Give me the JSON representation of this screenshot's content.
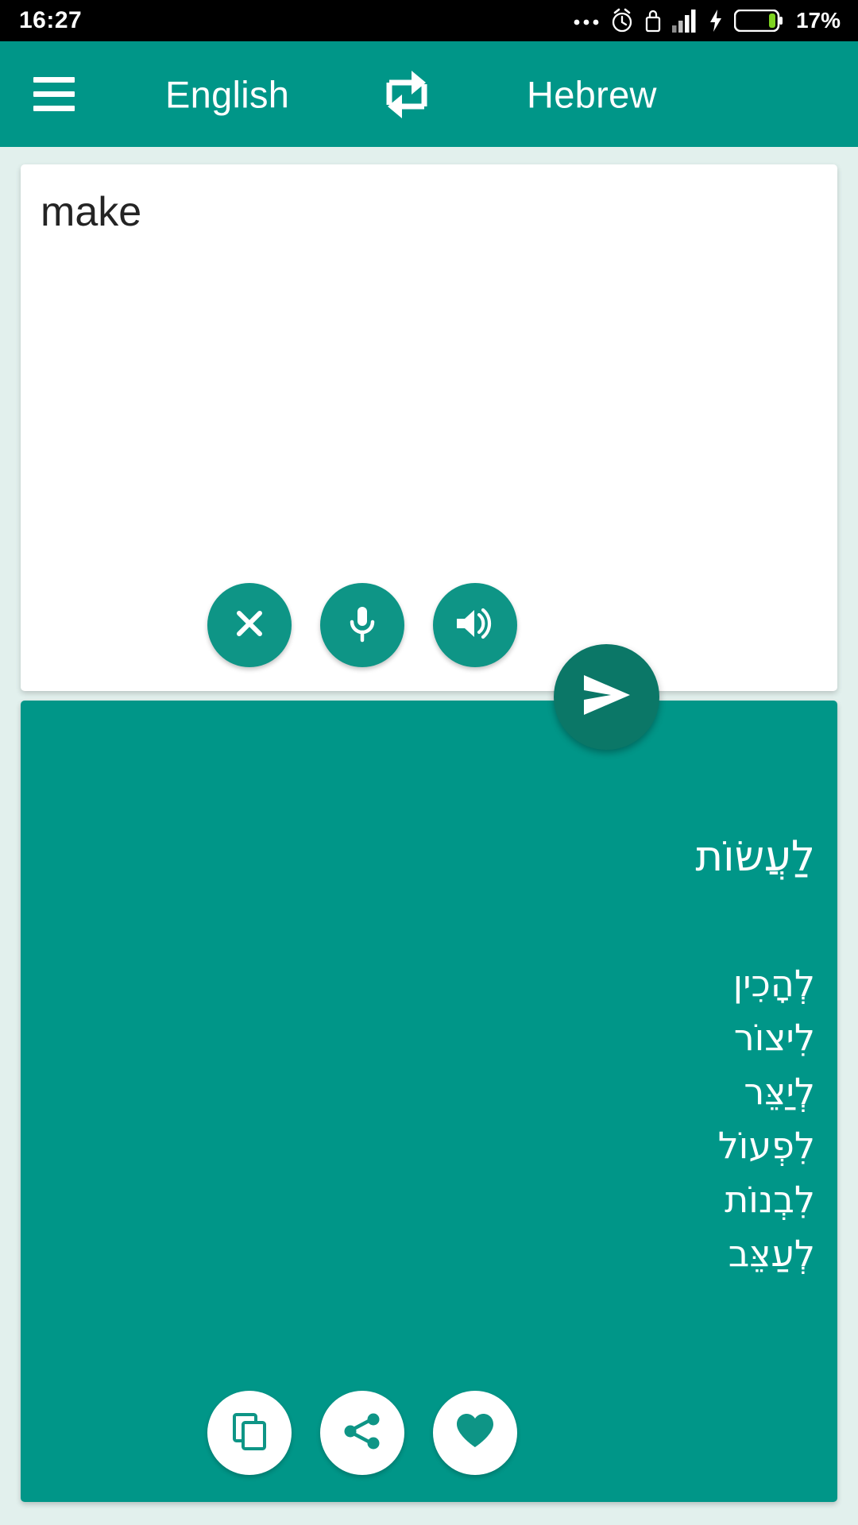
{
  "status_bar": {
    "time": "16:27",
    "battery_percent": "17%",
    "icons": [
      "more-dots-icon",
      "alarm-clock-icon",
      "lock-icon",
      "signal-bars-icon",
      "charging-bolt-icon",
      "battery-icon"
    ]
  },
  "toolbar": {
    "menu_icon": "hamburger-menu-icon",
    "source_language": "English",
    "swap_icon": "swap-languages-icon",
    "target_language": "Hebrew"
  },
  "input": {
    "text": "make",
    "placeholder": "",
    "actions": [
      {
        "name": "clear-button",
        "icon": "close-icon"
      },
      {
        "name": "voice-input-button",
        "icon": "microphone-icon"
      },
      {
        "name": "speak-source-button",
        "icon": "speaker-icon"
      }
    ]
  },
  "send": {
    "icon": "send-icon",
    "label": "Translate"
  },
  "result": {
    "main_translation": "לַעֲשׂוֹת",
    "alternatives": [
      "לְהָכִין",
      "לִיצוֹר",
      "לְיַצֵּר",
      "לִפְעוֹל",
      "לִבְנוֹת",
      "לְעַצֵּב"
    ],
    "actions": [
      {
        "name": "copy-button",
        "icon": "copy-icon"
      },
      {
        "name": "share-button",
        "icon": "share-icon"
      },
      {
        "name": "favorite-button",
        "icon": "heart-icon"
      }
    ]
  },
  "colors": {
    "primary_teal": "#009688",
    "fab_teal": "#0e9586",
    "send_fab_teal": "#0b7767",
    "page_background": "#e2f0ed",
    "card_white": "#ffffff",
    "status_bar_black": "#000000",
    "battery_green": "#7ed321"
  }
}
